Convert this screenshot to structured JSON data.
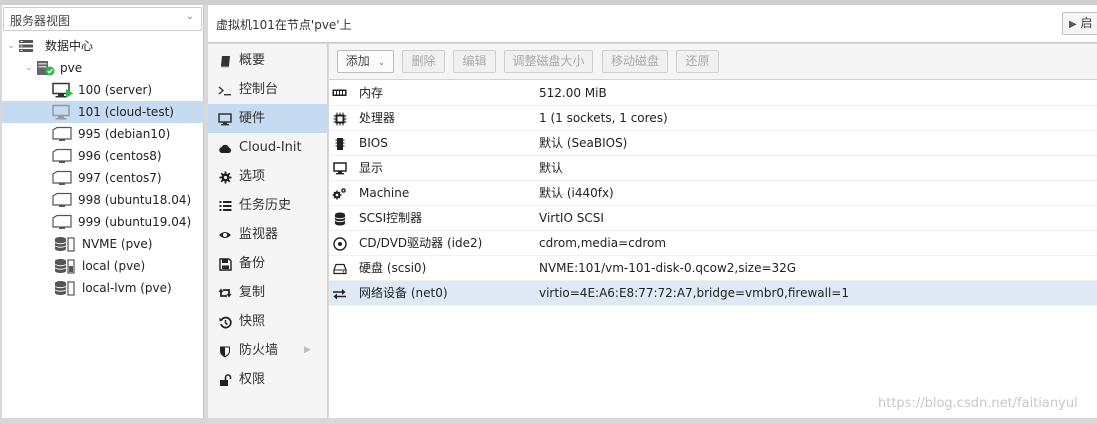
{
  "view_selector": {
    "label": "服务器视图"
  },
  "tree": {
    "datacenter": "数据中心",
    "node": "pve",
    "items": [
      {
        "label": "100 (server)",
        "kind": "vm-running"
      },
      {
        "label": "101 (cloud-test)",
        "kind": "vm-stopped"
      },
      {
        "label": "995 (debian10)",
        "kind": "template"
      },
      {
        "label": "996 (centos8)",
        "kind": "template"
      },
      {
        "label": "997 (centos7)",
        "kind": "template"
      },
      {
        "label": "998 (ubuntu18.04)",
        "kind": "template"
      },
      {
        "label": "999 (ubuntu19.04)",
        "kind": "template"
      },
      {
        "label": "NVME (pve)",
        "kind": "storage"
      },
      {
        "label": "local (pve)",
        "kind": "storage"
      },
      {
        "label": "local-lvm (pve)",
        "kind": "storage"
      }
    ]
  },
  "header": {
    "title": "虚拟机101在节点'pve'上",
    "start_button": "启"
  },
  "menu": {
    "items": [
      {
        "label": "概要",
        "icon": "book-icon"
      },
      {
        "label": "控制台",
        "icon": "terminal-icon"
      },
      {
        "label": "硬件",
        "icon": "desktop-icon"
      },
      {
        "label": "Cloud-Init",
        "icon": "cloud-icon"
      },
      {
        "label": "选项",
        "icon": "gear-icon"
      },
      {
        "label": "任务历史",
        "icon": "list-icon"
      },
      {
        "label": "监视器",
        "icon": "eye-icon"
      },
      {
        "label": "备份",
        "icon": "floppy-icon"
      },
      {
        "label": "复制",
        "icon": "retweet-icon"
      },
      {
        "label": "快照",
        "icon": "history-icon"
      },
      {
        "label": "防火墙",
        "icon": "shield-icon"
      },
      {
        "label": "权限",
        "icon": "unlock-icon"
      }
    ]
  },
  "toolbar": {
    "add": "添加",
    "remove": "删除",
    "edit": "编辑",
    "resize": "调整磁盘大小",
    "move": "移动磁盘",
    "revert": "还原"
  },
  "hardware": [
    {
      "name": "内存",
      "value": "512.00 MiB",
      "icon": "memory-icon"
    },
    {
      "name": "处理器",
      "value": "1 (1 sockets, 1 cores)",
      "icon": "cpu-icon"
    },
    {
      "name": "BIOS",
      "value": "默认 (SeaBIOS)",
      "icon": "microchip-icon"
    },
    {
      "name": "显示",
      "value": "默认",
      "icon": "monitor-icon"
    },
    {
      "name": "Machine",
      "value": "默认 (i440fx)",
      "icon": "cogs-icon"
    },
    {
      "name": "SCSI控制器",
      "value": "VirtIO SCSI",
      "icon": "database-icon"
    },
    {
      "name": "CD/DVD驱动器 (ide2)",
      "value": "cdrom,media=cdrom",
      "icon": "cdrom-icon"
    },
    {
      "name": "硬盘 (scsi0)",
      "value": "NVME:101/vm-101-disk-0.qcow2,size=32G",
      "icon": "hdd-icon"
    },
    {
      "name": "网络设备 (net0)",
      "value": "virtio=4E:A6:E8:77:72:A7,bridge=vmbr0,firewall=1",
      "icon": "exchange-icon"
    }
  ],
  "watermark": "https://blog.csdn.net/faitianyul",
  "colors": {
    "selection": "#c5dbf2",
    "running": "#21bf4b"
  }
}
